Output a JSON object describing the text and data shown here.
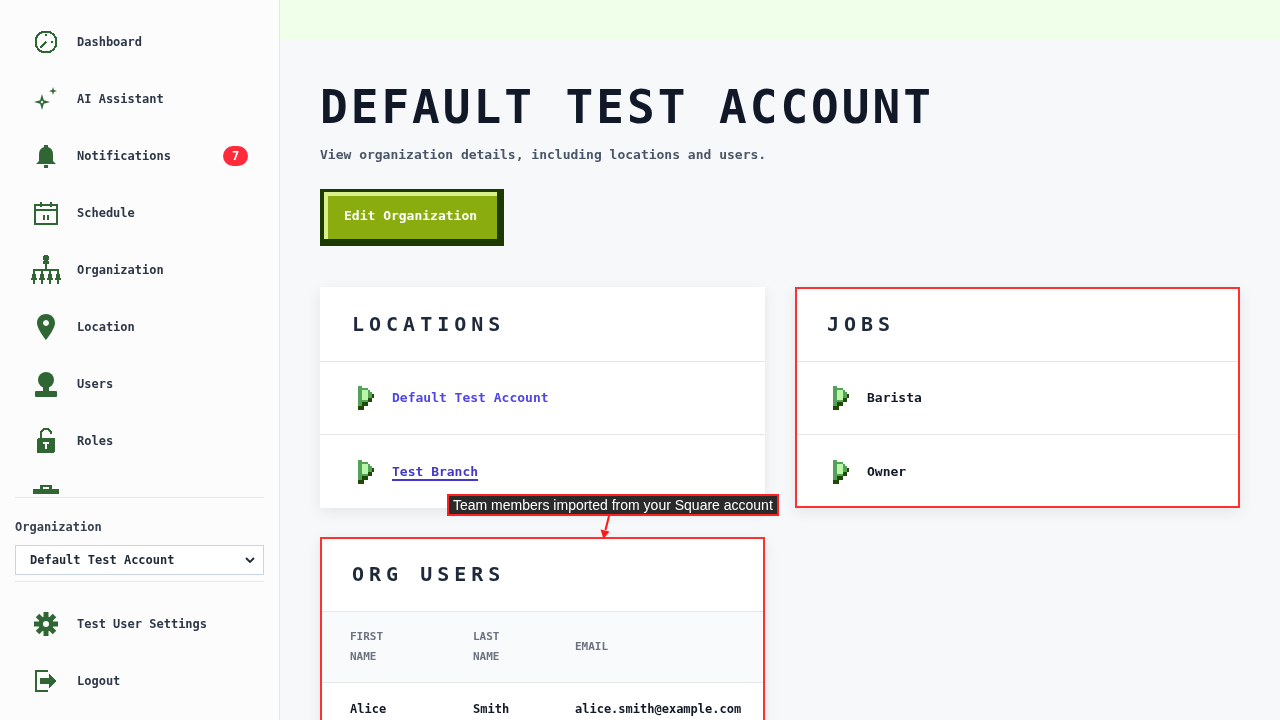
{
  "sidebar": {
    "nav_items": [
      {
        "label": "Dashboard"
      },
      {
        "label": "AI Assistant"
      },
      {
        "label": "Notifications",
        "badge": "7"
      },
      {
        "label": "Schedule"
      },
      {
        "label": "Organization"
      },
      {
        "label": "Location"
      },
      {
        "label": "Users"
      },
      {
        "label": "Roles"
      }
    ],
    "organization_picker": {
      "label": "Organization",
      "value": "Default Test Account"
    },
    "footer_items": [
      {
        "label": "Test User Settings"
      },
      {
        "label": "Logout"
      }
    ]
  },
  "page": {
    "title": "DEFAULT TEST ACCOUNT",
    "subtitle": "View organization details, including locations and users.",
    "primary_button": "Edit Organization"
  },
  "locations": {
    "title": "LOCATIONS",
    "highlighted": false,
    "items": [
      {
        "label": "Default Test Account",
        "underlined": false
      },
      {
        "label": "Test Branch",
        "underlined": true
      }
    ]
  },
  "jobs": {
    "title": "JOBS",
    "highlighted": true,
    "items": [
      {
        "label": "Barista"
      },
      {
        "label": "Owner"
      }
    ]
  },
  "annotation": {
    "text": "Team members imported from your Square account"
  },
  "org_users": {
    "title": "ORG USERS",
    "highlighted": true,
    "columns": [
      "FIRST NAME",
      "LAST NAME",
      "EMAIL"
    ],
    "rows": [
      [
        "Alice",
        "Smith",
        "alice.smith@example.com"
      ]
    ]
  }
}
